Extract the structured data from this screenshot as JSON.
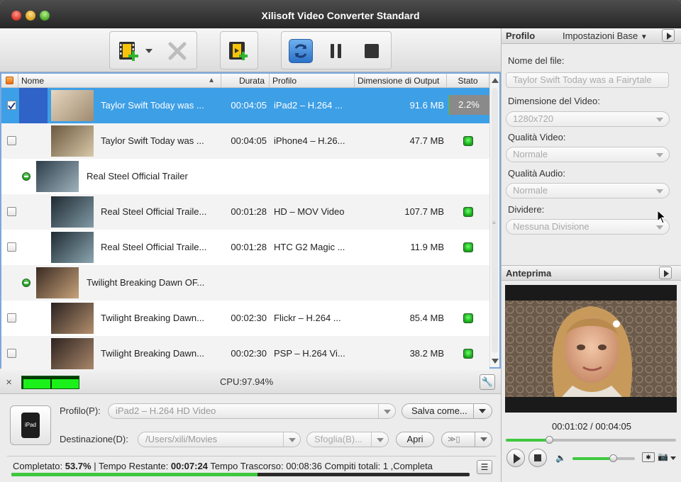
{
  "window": {
    "title": "Xilisoft Video Converter Standard"
  },
  "columns": {
    "name": "Nome",
    "duration": "Durata",
    "profile": "Profilo",
    "size": "Dimensione di Output",
    "status": "Stato"
  },
  "rows": [
    {
      "kind": "file",
      "selected": true,
      "checked": true,
      "name": "Taylor Swift Today was ...",
      "duration": "00:04:05",
      "profile": "iPad2 – H.264 ...",
      "size": "91.6 MB",
      "status": "2.2%",
      "progress": 0.022
    },
    {
      "kind": "file",
      "selected": false,
      "checked": false,
      "name": "Taylor Swift Today was ...",
      "duration": "00:04:05",
      "profile": "iPhone4 – H.26...",
      "size": "47.7 MB",
      "status": ""
    },
    {
      "kind": "group",
      "name": "Real Steel Official Trailer"
    },
    {
      "kind": "file",
      "selected": false,
      "checked": false,
      "name": "Real Steel Official Traile...",
      "duration": "00:01:28",
      "profile": "HD – MOV Video",
      "size": "107.7 MB",
      "status": ""
    },
    {
      "kind": "file",
      "selected": false,
      "checked": false,
      "name": "Real Steel Official Traile...",
      "duration": "00:01:28",
      "profile": "HTC G2 Magic ...",
      "size": "11.9 MB",
      "status": ""
    },
    {
      "kind": "group",
      "name": "Twilight Breaking Dawn OF..."
    },
    {
      "kind": "file",
      "selected": false,
      "checked": false,
      "name": "Twilight Breaking Dawn...",
      "duration": "00:02:30",
      "profile": "Flickr – H.264 ...",
      "size": "85.4 MB",
      "status": ""
    },
    {
      "kind": "file",
      "selected": false,
      "checked": false,
      "name": "Twilight Breaking Dawn...",
      "duration": "00:02:30",
      "profile": "PSP – H.264 Vi...",
      "size": "38.2 MB",
      "status": ""
    }
  ],
  "status_bar": {
    "cpu": "CPU:97.94%"
  },
  "bottom": {
    "profile_label": "Profilo(P):",
    "profile_value": "iPad2 – H.264 HD Video",
    "save_as": "Salva come...",
    "dest_label": "Destinazione(D):",
    "dest_value": "/Users/xili/Movies",
    "browse": "Sfoglia(B)...",
    "open": "Apri",
    "device_label": "iPad",
    "progress": {
      "completed_label": "Completato:",
      "completed_value": "53.7%",
      "remaining_label": "| Tempo Restante:",
      "remaining_value": "00:07:24",
      "elapsed_text": "Tempo Trascorso: 00:08:36 Compiti totali: 1 ,Completa",
      "fraction": 0.537
    }
  },
  "profile_panel": {
    "title": "Profilo",
    "preset": "Impostazioni Base",
    "filename_label": "Nome del file:",
    "filename_value": "Taylor Swift Today was a Fairytale",
    "video_size_label": "Dimensione del Video:",
    "video_size_value": "1280x720",
    "video_quality_label": "Qualità Video:",
    "video_quality_value": "Normale",
    "audio_quality_label": "Qualità Audio:",
    "audio_quality_value": "Normale",
    "split_label": "Dividere:",
    "split_value": "Nessuna Divisione"
  },
  "preview": {
    "title": "Anteprima",
    "time": "00:01:02 / 00:04:05",
    "position": 0.253,
    "volume": 0.65
  },
  "colors": {
    "selection": "#3d9fe6",
    "status_ok": "#22c422",
    "progress": "#3fc83f"
  }
}
